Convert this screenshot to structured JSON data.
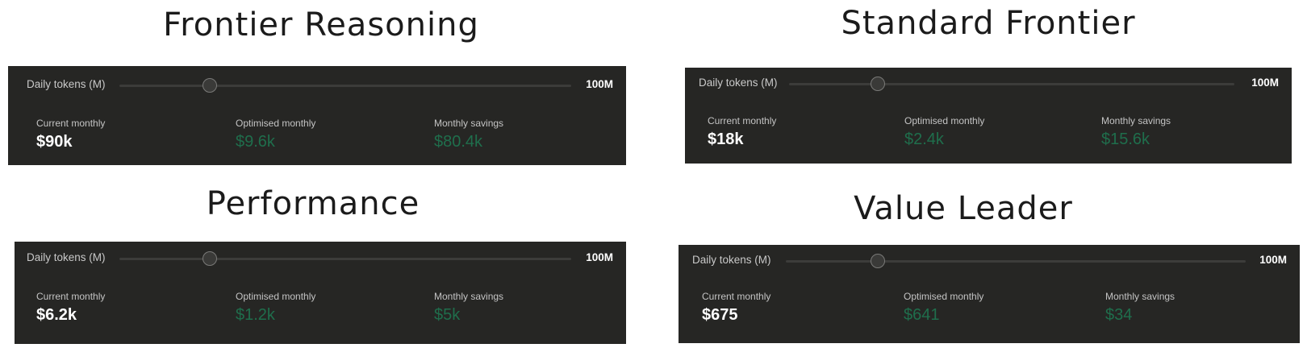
{
  "accent_colors": {
    "panel_background": "#262624",
    "savings_green": "#1f6e4c",
    "current_white": "#ffffff"
  },
  "panels": [
    {
      "title": "Frontier Reasoning",
      "slider_label": "Daily tokens (M)",
      "slider_max": "100M",
      "slider_value_fraction": 0.2,
      "current_label": "Current monthly",
      "current_value": "$90k",
      "optimised_label": "Optimised monthly",
      "optimised_value": "$9.6k",
      "savings_label": "Monthly savings",
      "savings_value": "$80.4k"
    },
    {
      "title": "Standard Frontier",
      "slider_label": "Daily tokens (M)",
      "slider_max": "100M",
      "slider_value_fraction": 0.2,
      "current_label": "Current monthly",
      "current_value": "$18k",
      "optimised_label": "Optimised monthly",
      "optimised_value": "$2.4k",
      "savings_label": "Monthly savings",
      "savings_value": "$15.6k"
    },
    {
      "title": "Performance",
      "slider_label": "Daily tokens (M)",
      "slider_max": "100M",
      "slider_value_fraction": 0.2,
      "current_label": "Current monthly",
      "current_value": "$6.2k",
      "optimised_label": "Optimised monthly",
      "optimised_value": "$1.2k",
      "savings_label": "Monthly savings",
      "savings_value": "$5k"
    },
    {
      "title": "Value Leader",
      "slider_label": "Daily tokens (M)",
      "slider_max": "100M",
      "slider_value_fraction": 0.2,
      "current_label": "Current monthly",
      "current_value": "$675",
      "optimised_label": "Optimised monthly",
      "optimised_value": "$641",
      "savings_label": "Monthly savings",
      "savings_value": "$34"
    }
  ]
}
